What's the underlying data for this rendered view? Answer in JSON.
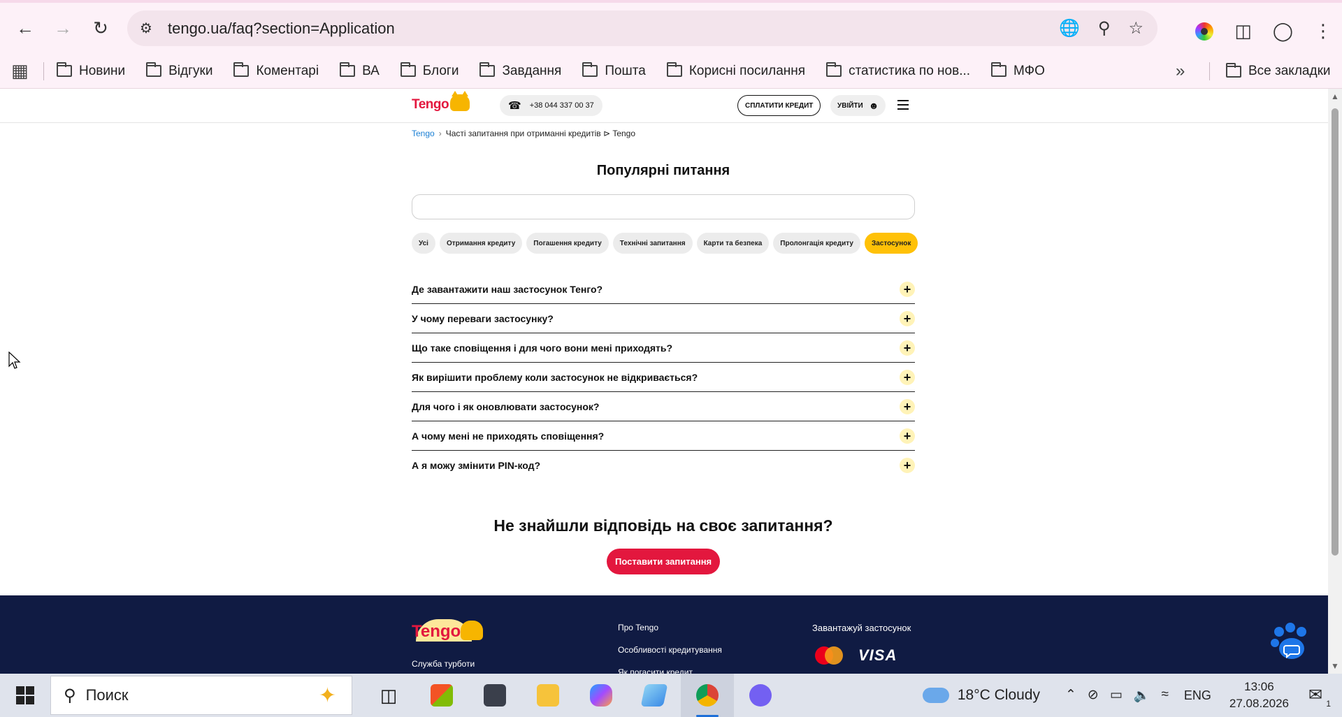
{
  "browser": {
    "url": "tengo.ua/faq?section=Application",
    "bookmarks": [
      "Новини",
      "Відгуки",
      "Коментарі",
      "ВА",
      "Блоги",
      "Завдання",
      "Пошта",
      "Корисні посилання",
      "статистика по нов...",
      "МФО"
    ],
    "all_bookmarks": "Все закладки"
  },
  "header": {
    "logo": "Tengo",
    "phone": "+38 044 337 00 37",
    "pay_label": "СПЛАТИТИ КРЕДИТ",
    "login_label": "УВІЙТИ"
  },
  "breadcrumb": {
    "home": "Tengo",
    "sep": "›",
    "current": "Часті запитання при отриманні кредитів ⊳ Tengo"
  },
  "faq": {
    "title": "Популярні питання",
    "search_value": "",
    "chips": [
      "Усі",
      "Отримання кредиту",
      "Погашення кредиту",
      "Технічні запитання",
      "Карти та безпека",
      "Пролонгація кредиту",
      "Застосунок"
    ],
    "active_chip": "Застосунок",
    "questions": [
      "Де завантажити наш застосунок Тенго?",
      "У чому переваги застосунку?",
      "Що таке сповіщення і для чого вони мені приходять?",
      "Як вирішити проблему коли застосунок не відкривається?",
      "Для чого і як оновлювати застосунок?",
      "А чому мені не приходять сповіщення?",
      "А я можу змінити PIN-код?"
    ],
    "plus": "+"
  },
  "cta": {
    "title": "Не знайшли відповідь на своє запитання?",
    "button": "Поставити запитання"
  },
  "footer": {
    "logo": "Tengo",
    "care": "Служба турботи",
    "links": [
      "Про Tengo",
      "Особливості кредитування",
      "Як погасити кредит"
    ],
    "app_title": "Завантажуй застосунок",
    "visa": "VISA"
  },
  "taskbar": {
    "search_placeholder": "Поиск",
    "weather": "18°C  Cloudy",
    "lang": "ENG",
    "time": "13:06",
    "date": "27.08.2026",
    "notifications": "1"
  },
  "colors": {
    "brand_red": "#e3173e",
    "brand_yellow": "#ffc107",
    "footer_navy": "#101b43"
  }
}
